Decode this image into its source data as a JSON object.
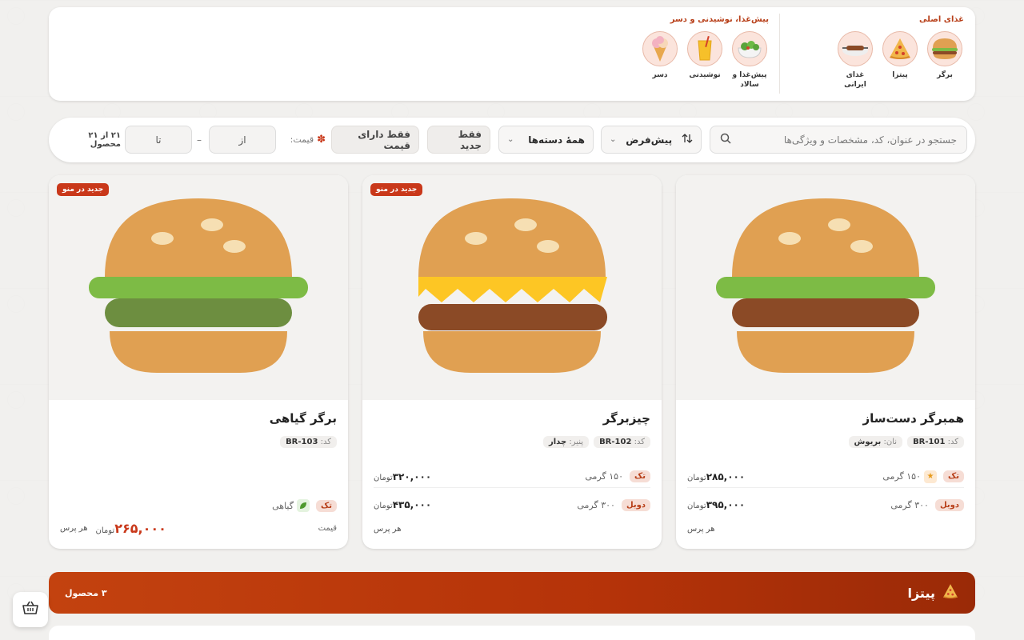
{
  "colors": {
    "accent": "#c9381a",
    "background": "#f1f0ee",
    "section_bar": "#b53309"
  },
  "categories": {
    "main_group_title": "غذای اصلی",
    "side_group_title": "پیش‌غذا، نوشیدنی و دسر",
    "main_items": [
      {
        "label": "برگر",
        "icon": "burger-icon"
      },
      {
        "label": "پیتزا",
        "icon": "pizza-icon"
      },
      {
        "label": "غذای ایرانی",
        "icon": "kebab-icon"
      }
    ],
    "side_items": [
      {
        "label": "پیش‌غذا و سالاد",
        "icon": "salad-icon"
      },
      {
        "label": "نوشیدنی",
        "icon": "drink-icon"
      },
      {
        "label": "دسر",
        "icon": "icecream-icon"
      }
    ]
  },
  "filters": {
    "search_placeholder": "جستجو در عنوان، کد، مشخصات و ویژگی‌ها",
    "sort_label": "پیش‌فرض",
    "category_label": "همهٔ دسته‌ها",
    "only_new": "فقط جدید",
    "only_priced": "فقط دارای قیمت",
    "price_label": "قیمت:",
    "price_from": "از",
    "price_to": "تا",
    "result_count": "۲۱ از ۲۱ محصول"
  },
  "products": [
    {
      "title": "همبرگر دست‌ساز",
      "code_label": "کد:",
      "code": "BR-101",
      "attr_label": "نان:",
      "attr_value": "بریوش",
      "new_badge": "",
      "variants": [
        {
          "badge": "تک",
          "extra": "۱۵۰ گرمی",
          "price": "۲۸۵,۰۰۰",
          "currency": "تومان"
        },
        {
          "badge": "دوبل",
          "extra": "۳۰۰ گرمی",
          "price": "۳۹۵,۰۰۰",
          "currency": "تومان"
        }
      ],
      "per": "هر پرس"
    },
    {
      "title": "چیزبرگر",
      "code_label": "کد:",
      "code": "BR-102",
      "attr_label": "پنیر:",
      "attr_value": "چدار",
      "new_badge": "جدید در منو",
      "variants": [
        {
          "badge": "تک",
          "extra": "۱۵۰ گرمی",
          "price": "۳۲۰,۰۰۰",
          "currency": "تومان"
        },
        {
          "badge": "دوبل",
          "extra": "۳۰۰ گرمی",
          "price": "۴۳۵,۰۰۰",
          "currency": "تومان"
        }
      ],
      "per": "هر پرس"
    },
    {
      "title": "برگر گیاهی",
      "code_label": "کد:",
      "code": "BR-103",
      "new_badge": "جدید در منو",
      "variant_badge": "تک",
      "variant_extra": "گیاهی",
      "price_label": "قیمت",
      "price": "۲۶۵,۰۰۰",
      "currency": "تومان",
      "per": "هر پرس"
    }
  ],
  "section": {
    "title": "پیتزا",
    "count": "۳ محصول"
  }
}
